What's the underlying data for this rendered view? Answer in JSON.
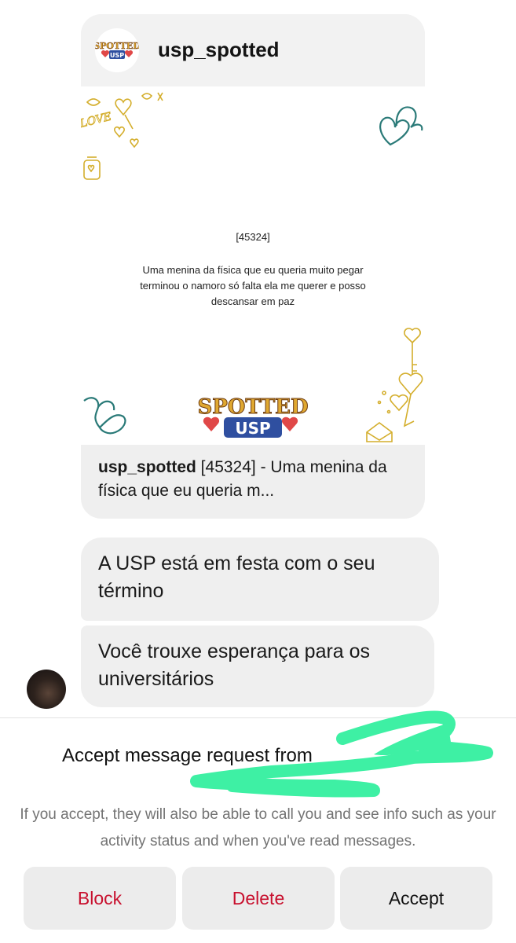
{
  "post": {
    "username": "usp_spotted",
    "logo_text": [
      "SPOTTED",
      "USP"
    ],
    "image_id": "[45324]",
    "image_text": "Uma menina da física que eu queria muito pegar terminou o namoro só falta ela me querer e posso descansar em paz",
    "image_love_text": "LOVE",
    "caption_user": "usp_spotted",
    "caption_text": " [45324] - Uma menina da física que eu queria m..."
  },
  "messages": [
    {
      "text": "A USP está em festa com o seu término"
    },
    {
      "text": "Você trouxe esperança para os universitários"
    }
  ],
  "request": {
    "title": "Accept message request from ",
    "info": "If you accept, they will also be able to call you and see info such as your activity status and when you've read messages."
  },
  "buttons": {
    "block": "Block",
    "delete": "Delete",
    "accept": "Accept"
  },
  "colors": {
    "danger": "#c8102e",
    "bubble": "#efefef",
    "redaction": "#3ef0a4",
    "accent_teal": "#2a7a78",
    "accent_gold": "#d4ae2c"
  }
}
